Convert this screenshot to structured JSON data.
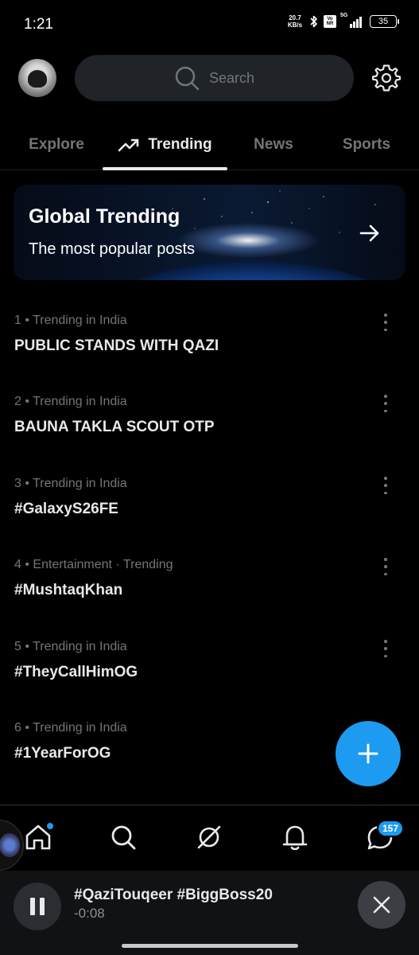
{
  "status_bar": {
    "time": "1:21",
    "net_speed_value": "20.7",
    "net_speed_unit": "KB/s",
    "network": "5G",
    "battery": "35"
  },
  "header": {
    "search_placeholder": "Search"
  },
  "tabs": [
    {
      "label": "Explore",
      "active": false
    },
    {
      "label": "Trending",
      "active": true
    },
    {
      "label": "News",
      "active": false
    },
    {
      "label": "Sports",
      "active": false
    }
  ],
  "banner": {
    "title": "Global Trending",
    "subtitle": "The most popular posts"
  },
  "trends": [
    {
      "meta": "1 • Trending in India",
      "name": "PUBLIC STANDS WITH QAZI"
    },
    {
      "meta": "2 • Trending in India",
      "name": "BAUNA TAKLA SCOUT OTP"
    },
    {
      "meta": "3 • Trending in India",
      "name": "#GalaxyS26FE"
    },
    {
      "meta": "4 • Entertainment · Trending",
      "name": "#MushtaqKhan"
    },
    {
      "meta": "5 • Trending in India",
      "name": "#TheyCallHimOG"
    },
    {
      "meta": "6 • Trending in India",
      "name": "#1YearForOG"
    }
  ],
  "bottom_nav": {
    "messages_badge": "157"
  },
  "media": {
    "title": "#QaziTouqeer  #BiggBoss20",
    "time": "-0:08"
  },
  "colors": {
    "accent": "#1d9bf0",
    "background": "#000000",
    "muted_text": "#71767b",
    "primary_text": "#e7e9ea"
  }
}
